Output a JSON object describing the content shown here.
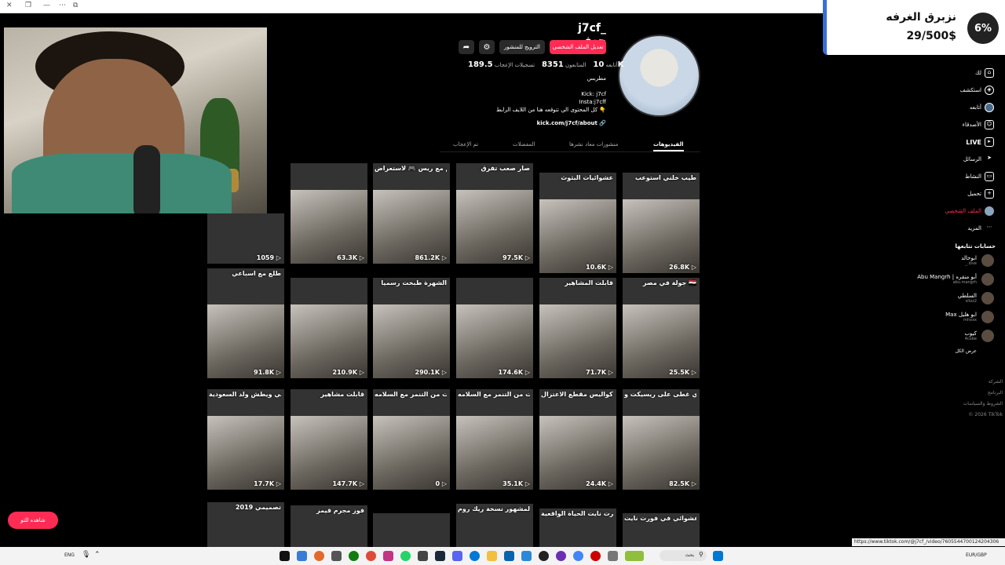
{
  "profile": {
    "username": "j7cf_  جعف",
    "edit_button": "تعديل الملف الشخصي",
    "promote_button": "الترويج للمنشور",
    "stats": {
      "following_value": "10",
      "following_label": "أتابعه",
      "followers_value": "8351",
      "followers_label": "المتابعون",
      "likes_value": "189.5K",
      "likes_label": "تسجيلات الإعجاب"
    },
    "bio_role": "مطربس",
    "bio_lines": [
      "Kick: j7cf",
      "Insta:j7cff",
      "كل المحتوى الي تتوقعه هنا من اللايف الرابط 👇"
    ],
    "link": "kick.com/j7cf/about"
  },
  "tabs": [
    {
      "label": "الفيديوهات"
    },
    {
      "label": "منشورات معاد نشرها"
    },
    {
      "label": "المفضلات"
    },
    {
      "label": "تم الإعجاب"
    }
  ],
  "videos": [
    {
      "caption": "طيب خلني استوعب",
      "views": "26.8K"
    },
    {
      "caption": "عشوائيات البثوث",
      "views": "10.6K"
    },
    {
      "caption": "صار صعب تفرق",
      "views": "97.5K"
    },
    {
      "caption": "قيم مع ريس 🎮 لاستعراض",
      "views": "861.2K"
    },
    {
      "caption": "",
      "views": "63.3K"
    },
    {
      "caption": "",
      "views": "1059"
    },
    {
      "caption": "جولة في مصر 🇪🇬",
      "views": "25.5K"
    },
    {
      "caption": "قابلت المشاهير",
      "views": "71.7K"
    },
    {
      "caption": "",
      "views": "174.6K"
    },
    {
      "caption": "الشهرة طبخت رسمياً",
      "views": "290.1K"
    },
    {
      "caption": "",
      "views": "210.9K"
    },
    {
      "caption": "طلع مع اسباعي",
      "views": "91.8K"
    },
    {
      "caption": "المتطوري غطى على ريسيكت وMT سيرفرات",
      "views": "82.5K"
    },
    {
      "caption": "كواليس مقطع الاعتزال 😂",
      "views": "24.4K"
    },
    {
      "caption": "تعبت من التنمر مع السلامه 💔",
      "views": "35.1K"
    },
    {
      "caption": "تعبت من التنمر مع السلامه 💔",
      "views": "0"
    },
    {
      "caption": "قابلت مشاهير",
      "views": "147.7K"
    },
    {
      "caption": "واحد يسوي نفسه اجنبي ويطش ولد السعودية",
      "views": "17.7K"
    },
    {
      "caption": "اكثر شاب عشوائي في فورت نايت",
      "views": ""
    },
    {
      "caption": "فورت نايت الحياة الواقعية",
      "views": ""
    },
    {
      "caption": "المقطع المشهور نسخة ريك روم",
      "views": ""
    },
    {
      "caption": "",
      "views": ""
    },
    {
      "caption": "فوز مجرم قيمز",
      "views": ""
    },
    {
      "caption": "تصميمي 2019",
      "views": ""
    }
  ],
  "sidebar": {
    "nav": [
      {
        "label": "لك",
        "icon": "home-icon"
      },
      {
        "label": "استكشف",
        "icon": "compass-icon"
      },
      {
        "label": "أتابعه",
        "icon": "avatar-icon"
      },
      {
        "label": "الأصدقاء",
        "icon": "friends-icon"
      },
      {
        "label": "LIVE",
        "icon": "live-icon"
      },
      {
        "label": "الرسائل",
        "icon": "send-icon"
      },
      {
        "label": "النشاط",
        "icon": "inbox-icon"
      },
      {
        "label": "تحميل",
        "icon": "upload-icon"
      },
      {
        "label": "الملف الشخصي",
        "icon": "profile-icon"
      },
      {
        "label": "المزيد",
        "icon": "more-icon"
      }
    ],
    "following_title": "حسابات تتابعها",
    "following": [
      {
        "name": "ابوخالد",
        "handle": "_.iove"
      },
      {
        "name": "Abu Mangrh | أبو منقره",
        "handle": "abu.mangrh"
      },
      {
        "name": "السلطي",
        "handle": "sltzz2"
      },
      {
        "name": "Max ابو هليل",
        "handle": "mhxxx"
      },
      {
        "name": "كيوب",
        "handle": "4cobe"
      }
    ],
    "see_all": "عرض الكل",
    "footer": [
      "الشركة",
      "البرنامج",
      "الشروط والسياسات",
      "© 2026 TikTok"
    ]
  },
  "goal": {
    "percent": "6%",
    "title": "نزبرق الغرفه",
    "value": "29/500$"
  },
  "watch_button": "شاهده للتو",
  "status_url": "https://www.tiktok.com/@j7cf_/video/7605544700124204306",
  "taskbar": {
    "lang": "ENG",
    "search": "بحث",
    "currency": "EUR/GBP"
  }
}
